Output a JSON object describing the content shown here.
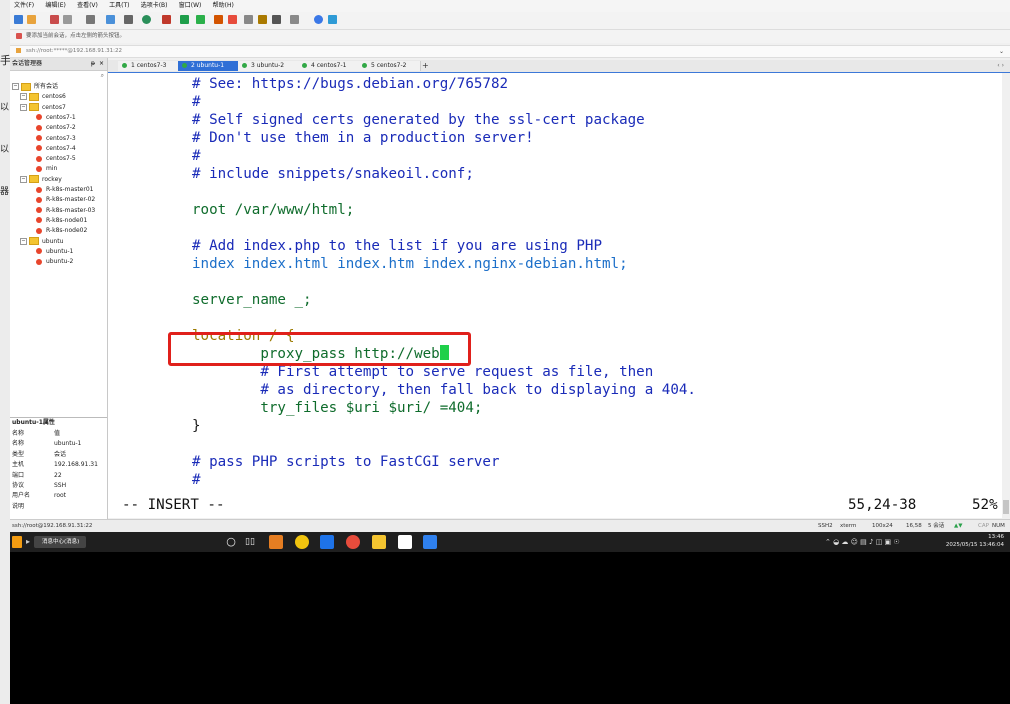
{
  "left_strip": [
    "手",
    "以",
    "以",
    "器"
  ],
  "menu": [
    "文件(F)",
    "编辑(E)",
    "查看(V)",
    "工具(T)",
    "选项卡(B)",
    "窗口(W)",
    "帮助(H)"
  ],
  "notice_text": "要添加当前会话，点击左侧的箭头按钮。",
  "address": "ssh://root:*****@192.168.91.31:22",
  "session_manager": {
    "title": "会话管理器",
    "items": [
      {
        "label": "所有会话",
        "type": "folder",
        "level": 0
      },
      {
        "label": "centos6",
        "type": "folder",
        "level": 1
      },
      {
        "label": "centos7",
        "type": "folder",
        "level": 1
      },
      {
        "label": "centos7-1",
        "type": "session",
        "level": 2
      },
      {
        "label": "centos7-2",
        "type": "session",
        "level": 2
      },
      {
        "label": "centos7-3",
        "type": "session",
        "level": 2
      },
      {
        "label": "centos7-4",
        "type": "session",
        "level": 2
      },
      {
        "label": "centos7-5",
        "type": "session",
        "level": 2
      },
      {
        "label": "min",
        "type": "session",
        "level": 2
      },
      {
        "label": "rockey",
        "type": "folder",
        "level": 1
      },
      {
        "label": "R-k8s-master01",
        "type": "session",
        "level": 2
      },
      {
        "label": "R-k8s-master-02",
        "type": "session",
        "level": 2
      },
      {
        "label": "R-k8s-master-03",
        "type": "session",
        "level": 2
      },
      {
        "label": "R-k8s-node01",
        "type": "session",
        "level": 2
      },
      {
        "label": "R-k8s-node02",
        "type": "session",
        "level": 2
      },
      {
        "label": "ubuntu",
        "type": "folder",
        "level": 1
      },
      {
        "label": "ubuntu-1",
        "type": "session",
        "level": 2
      },
      {
        "label": "ubuntu-2",
        "type": "session",
        "level": 2
      }
    ]
  },
  "properties": {
    "title": "ubuntu-1属性",
    "rows": [
      {
        "k": "名称",
        "v": "值"
      },
      {
        "k": "名称",
        "v": "ubuntu-1"
      },
      {
        "k": "类型",
        "v": "会话"
      },
      {
        "k": "主机",
        "v": "192.168.91.31"
      },
      {
        "k": "端口",
        "v": "22"
      },
      {
        "k": "协议",
        "v": "SSH"
      },
      {
        "k": "用户名",
        "v": "root"
      },
      {
        "k": "说明",
        "v": ""
      }
    ]
  },
  "tabs": [
    {
      "label": "1 centos7-3",
      "active": false
    },
    {
      "label": "2 ubuntu-1",
      "active": true
    },
    {
      "label": "3 ubuntu-2",
      "active": false
    },
    {
      "label": "4 centos7-1",
      "active": false
    },
    {
      "label": "5 centos7-2",
      "active": false
    }
  ],
  "terminal": {
    "lines": [
      "# See: https://bugs.debian.org/765782",
      "#",
      "# Self signed certs generated by the ssl-cert package",
      "# Don't use them in a production server!",
      "#",
      "# include snippets/snakeoil.conf;",
      "",
      "root /var/www/html;",
      "",
      "# Add index.php to the list if you are using PHP",
      "index index.html index.htm index.nginx-debian.html;",
      "",
      "server_name _;",
      "",
      "location / {",
      "        proxy_pass http://web",
      "        # First attempt to serve request as file, then",
      "        # as directory, then fall back to displaying a 404.",
      "        try_files $uri $uri/ =404;",
      "}",
      "",
      "# pass PHP scripts to FastCGI server",
      "#"
    ],
    "mode": "-- INSERT --",
    "position": "55,24-38",
    "percent": "52%"
  },
  "status_bar": {
    "left": "ssh://root@192.168.91.31:22",
    "items": [
      "SSH2",
      "xterm",
      "100x24",
      "16,58",
      "5 会话",
      "CAP",
      "NUM"
    ]
  },
  "taskbar": {
    "app_label": "消息中心(消息)",
    "time": "13:46",
    "date": "2025/05/15 13:46:04"
  }
}
